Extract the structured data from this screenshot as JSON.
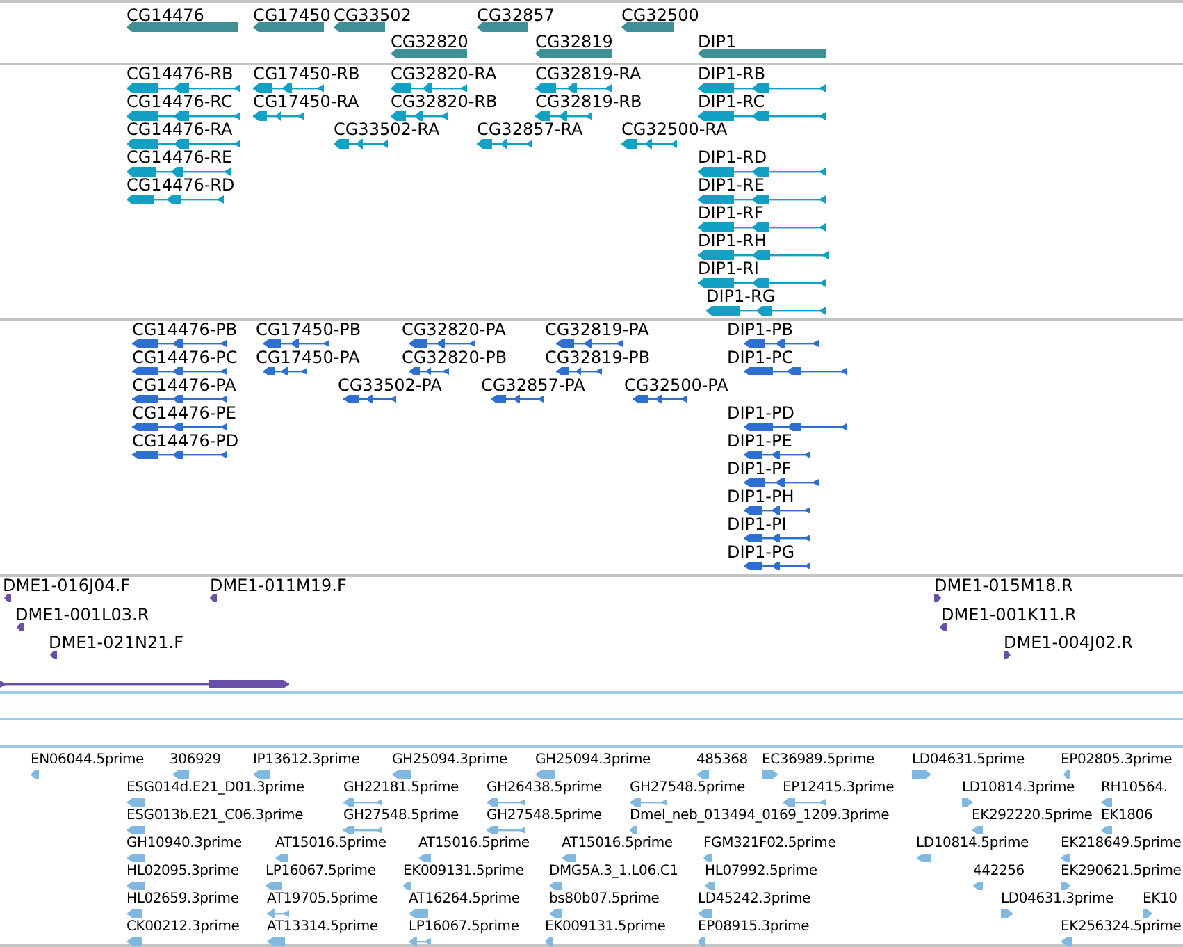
{
  "tracks": [
    {
      "kind": "gene",
      "features": [
        {
          "label": "CG14476",
          "reverse": true
        },
        {
          "label": "CG17450",
          "reverse": true
        },
        {
          "label": "CG33502",
          "reverse": true
        },
        {
          "label": "CG32857",
          "reverse": true
        },
        {
          "label": "CG32500",
          "reverse": true
        },
        {
          "label": "CG32820",
          "reverse": true
        },
        {
          "label": "CG32819",
          "reverse": true
        },
        {
          "label": "DIP1",
          "reverse": true
        }
      ]
    },
    {
      "kind": "transcript",
      "features": [
        {
          "label": "CG14476-RB",
          "reverse": true
        },
        {
          "label": "CG17450-RB",
          "reverse": true
        },
        {
          "label": "CG32820-RA",
          "reverse": true
        },
        {
          "label": "CG32819-RA",
          "reverse": true
        },
        {
          "label": "DIP1-RB",
          "reverse": true
        },
        {
          "label": "CG14476-RC",
          "reverse": true
        },
        {
          "label": "CG17450-RA",
          "reverse": true
        },
        {
          "label": "CG32820-RB",
          "reverse": true
        },
        {
          "label": "CG32819-RB",
          "reverse": true
        },
        {
          "label": "DIP1-RC",
          "reverse": true
        },
        {
          "label": "CG14476-RA",
          "reverse": true
        },
        {
          "label": "CG33502-RA",
          "reverse": true
        },
        {
          "label": "CG32857-RA",
          "reverse": true
        },
        {
          "label": "CG32500-RA",
          "reverse": true
        },
        {
          "label": "CG14476-RE",
          "reverse": true
        },
        {
          "label": "DIP1-RD",
          "reverse": true
        },
        {
          "label": "CG14476-RD",
          "reverse": true
        },
        {
          "label": "DIP1-RE",
          "reverse": true
        },
        {
          "label": "DIP1-RF",
          "reverse": true
        },
        {
          "label": "DIP1-RH",
          "reverse": true
        },
        {
          "label": "DIP1-RI",
          "reverse": true
        },
        {
          "label": "DIP1-RG",
          "reverse": true
        }
      ]
    },
    {
      "kind": "protein",
      "features": [
        {
          "label": "CG14476-PB",
          "reverse": true
        },
        {
          "label": "CG17450-PB",
          "reverse": true
        },
        {
          "label": "CG32820-PA",
          "reverse": true
        },
        {
          "label": "CG32819-PA",
          "reverse": true
        },
        {
          "label": "DIP1-PB",
          "reverse": true
        },
        {
          "label": "CG14476-PC",
          "reverse": true
        },
        {
          "label": "CG17450-PA",
          "reverse": true
        },
        {
          "label": "CG32820-PB",
          "reverse": true
        },
        {
          "label": "CG32819-PB",
          "reverse": true
        },
        {
          "label": "DIP1-PC",
          "reverse": true
        },
        {
          "label": "CG14476-PA",
          "reverse": true
        },
        {
          "label": "CG33502-PA",
          "reverse": true
        },
        {
          "label": "CG32857-PA",
          "reverse": true
        },
        {
          "label": "CG32500-PA",
          "reverse": true
        },
        {
          "label": "CG14476-PE",
          "reverse": true
        },
        {
          "label": "DIP1-PD",
          "reverse": true
        },
        {
          "label": "CG14476-PD",
          "reverse": true
        },
        {
          "label": "DIP1-PE",
          "reverse": true
        },
        {
          "label": "DIP1-PF",
          "reverse": true
        },
        {
          "label": "DIP1-PH",
          "reverse": true
        },
        {
          "label": "DIP1-PI",
          "reverse": true
        },
        {
          "label": "DIP1-PG",
          "reverse": true
        }
      ]
    },
    {
      "kind": "clone",
      "features": [
        {
          "label": "DME1-016J04.F",
          "reverse": true
        },
        {
          "label": "DME1-011M19.F",
          "reverse": true
        },
        {
          "label": "DME1-015M18.R",
          "reverse": false
        },
        {
          "label": "DME1-001L03.R",
          "reverse": true
        },
        {
          "label": "DME1-001K11.R",
          "reverse": true
        },
        {
          "label": "DME1-021N21.F",
          "reverse": true
        },
        {
          "label": "DME1-004J02.R",
          "reverse": false
        },
        {
          "reverse": false
        }
      ]
    },
    {
      "kind": "est",
      "features": [
        {
          "label": "EN06044.5prime",
          "reverse": true
        },
        {
          "label": "306929",
          "reverse": true
        },
        {
          "label": "IP13612.3prime",
          "reverse": true
        },
        {
          "label": "GH25094.3prime",
          "reverse": true
        },
        {
          "label": "GH25094.3prime",
          "reverse": true
        },
        {
          "label": "485368",
          "reverse": true
        },
        {
          "label": "EC36989.5prime",
          "reverse": false
        },
        {
          "label": "LD04631.5prime",
          "reverse": false
        },
        {
          "label": "EP02805.3prime",
          "reverse": true
        },
        {
          "label": "ESG014d.E21_D01.3prime",
          "reverse": true
        },
        {
          "label": "GH22181.5prime",
          "reverse": true
        },
        {
          "label": "GH26438.5prime",
          "reverse": true
        },
        {
          "label": "GH27548.5prime",
          "reverse": true
        },
        {
          "label": "EP12415.3prime",
          "reverse": true
        },
        {
          "label": "LD10814.3prime",
          "reverse": false
        },
        {
          "label": "RH10564.",
          "reverse": true
        },
        {
          "label": "ESG013b.E21_C06.3prime",
          "reverse": true
        },
        {
          "label": "GH27548.5prime",
          "reverse": true
        },
        {
          "label": "GH27548.5prime",
          "reverse": true
        },
        {
          "label": "Dmel_neb_013494_0169_1209.3prime",
          "reverse": true
        },
        {
          "label": "EK292220.5prime",
          "reverse": true
        },
        {
          "label": "EK1806",
          "reverse": true
        },
        {
          "label": "GH10940.3prime",
          "reverse": true
        },
        {
          "label": "AT15016.5prime",
          "reverse": true
        },
        {
          "label": "AT15016.5prime",
          "reverse": true
        },
        {
          "label": "AT15016.5prime",
          "reverse": true
        },
        {
          "label": "FGM321F02.5prime",
          "reverse": true
        },
        {
          "label": "LD10814.5prime",
          "reverse": true
        },
        {
          "label": "EK218649.5prime",
          "reverse": true
        },
        {
          "label": "HL02095.3prime",
          "reverse": true
        },
        {
          "label": "LP16067.5prime",
          "reverse": true
        },
        {
          "label": "EK009131.5prime",
          "reverse": true
        },
        {
          "label": "DMG5A.3_1.L06.C1",
          "reverse": true
        },
        {
          "label": "HL07992.5prime",
          "reverse": true
        },
        {
          "label": "442256",
          "reverse": true
        },
        {
          "label": "EK290621.5prime",
          "reverse": false
        },
        {
          "label": "HL02659.3prime",
          "reverse": true
        },
        {
          "label": "AT19705.5prime",
          "reverse": true
        },
        {
          "label": "AT16264.5prime",
          "reverse": true
        },
        {
          "label": "bs80b07.5prime",
          "reverse": true
        },
        {
          "label": "LD45242.3prime",
          "reverse": true
        },
        {
          "label": "LD04631.3prime",
          "reverse": false
        },
        {
          "label": "EK10",
          "reverse": false
        },
        {
          "label": "CK00212.3prime",
          "reverse": true
        },
        {
          "label": "AT13314.5prime",
          "reverse": true
        },
        {
          "label": "LP16067.5prime",
          "reverse": true
        },
        {
          "label": "EK009131.5prime",
          "reverse": true
        },
        {
          "label": "EP08915.3prime",
          "reverse": true
        },
        {
          "label": "EK256324.5prime",
          "reverse": true
        }
      ]
    }
  ]
}
